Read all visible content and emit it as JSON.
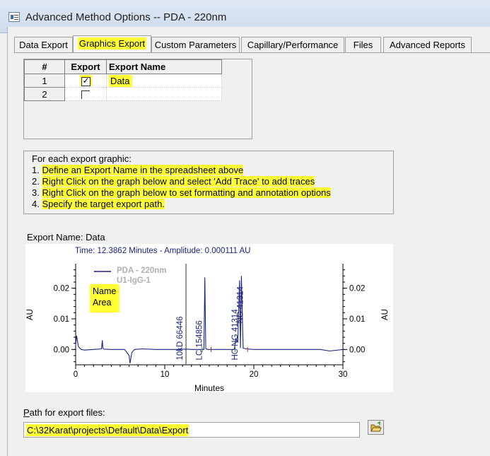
{
  "window": {
    "title": "Advanced Method Options -- PDA - 220nm",
    "icon": "app-window-icon"
  },
  "tabs": [
    {
      "label": "Data Export",
      "active": false
    },
    {
      "label": "Graphics Export",
      "active": true
    },
    {
      "label": "Custom Parameters",
      "active": false
    },
    {
      "label": "Capillary/Performance",
      "active": false
    },
    {
      "label": "Files",
      "active": false
    },
    {
      "label": "Advanced Reports",
      "active": false
    }
  ],
  "export_grid": {
    "headers": [
      "#",
      "Export",
      "Export Name"
    ],
    "rows": [
      {
        "num": "1",
        "checked": true,
        "name": "Data"
      },
      {
        "num": "2",
        "checked": false,
        "name": ""
      }
    ]
  },
  "instructions": {
    "heading": "For each export graphic:",
    "steps": [
      {
        "num": "1. ",
        "text": "Define an Export Name in the spreadsheet above"
      },
      {
        "num": "2. ",
        "text": "Right Click on the graph below and select 'Add Trace' to add traces"
      },
      {
        "num": "3. ",
        "text": "Right Click on the graph below to set formatting and annotation options"
      },
      {
        "num": "4. ",
        "text": "Specify the target export path."
      }
    ]
  },
  "graph": {
    "export_name_label": "Export Name: Data",
    "cursor_readout": "Time:  12.3862 Minutes - Amplitude:  0.000111 AU",
    "legend_line1": "PDA - 220nm",
    "legend_line2": "U1-IgG-1",
    "annotation_line1": "Name",
    "annotation_line2": "Area",
    "trace_color": "#1a237e",
    "highlight_color": "#ffff33"
  },
  "chart_data": {
    "type": "line",
    "xlabel": "Minutes",
    "ylabel": "AU",
    "xlim": [
      0,
      30
    ],
    "ylim": [
      -0.005,
      0.028
    ],
    "x_ticks": [
      "0",
      "10",
      "20",
      "30"
    ],
    "y_ticks": [
      "0.00",
      "0.01",
      "0.02"
    ],
    "cursor_x": 12.3862,
    "series": [
      {
        "name": "PDA - 220nm",
        "x": [
          0,
          0.1,
          0.3,
          0.6,
          1.0,
          2.0,
          2.9,
          3.0,
          3.05,
          3.2,
          4.0,
          5.5,
          6.0,
          6.1,
          6.3,
          6.6,
          7.5,
          9.0,
          11.5,
          12.3,
          12.5,
          13.0,
          14.4,
          14.5,
          14.6,
          14.8,
          15.5,
          17.0,
          17.8,
          18.0,
          18.2,
          18.4,
          18.5,
          18.6,
          18.8,
          19.2,
          20.0,
          22.0,
          25.0,
          27.5,
          28.5,
          30.0
        ],
        "y": [
          0.0015,
          0.0045,
          0.001,
          0.0,
          -0.0002,
          0.0,
          0.0002,
          0.003,
          0.0004,
          0.0001,
          0.0,
          0.0,
          -0.002,
          -0.0045,
          -0.001,
          0.0,
          0.0002,
          0.0,
          0.0,
          0.0001,
          0.0001,
          0.0,
          0.0,
          0.0235,
          0.0003,
          0.0,
          0.0,
          0.0,
          0.0,
          0.0035,
          0.0025,
          0.0225,
          0.0005,
          0.024,
          0.0004,
          0.0002,
          0.0,
          0.0,
          0.0,
          0.0,
          -0.0005,
          0.0
        ]
      }
    ],
    "peak_labels": [
      {
        "text": "10kD  66446",
        "x": 12.3
      },
      {
        "text": "LC  154856",
        "x": 14.5
      },
      {
        "text": "HC  NG  41314",
        "x": 18.5
      },
      {
        "text": "NG  41314",
        "x": 18.6
      }
    ]
  },
  "path": {
    "label_prefix": "P",
    "label_rest": "ath for export files:",
    "value": "C:\\32Karat\\projects\\Default\\Data\\Export",
    "browse_icon": "open-folder-icon"
  }
}
